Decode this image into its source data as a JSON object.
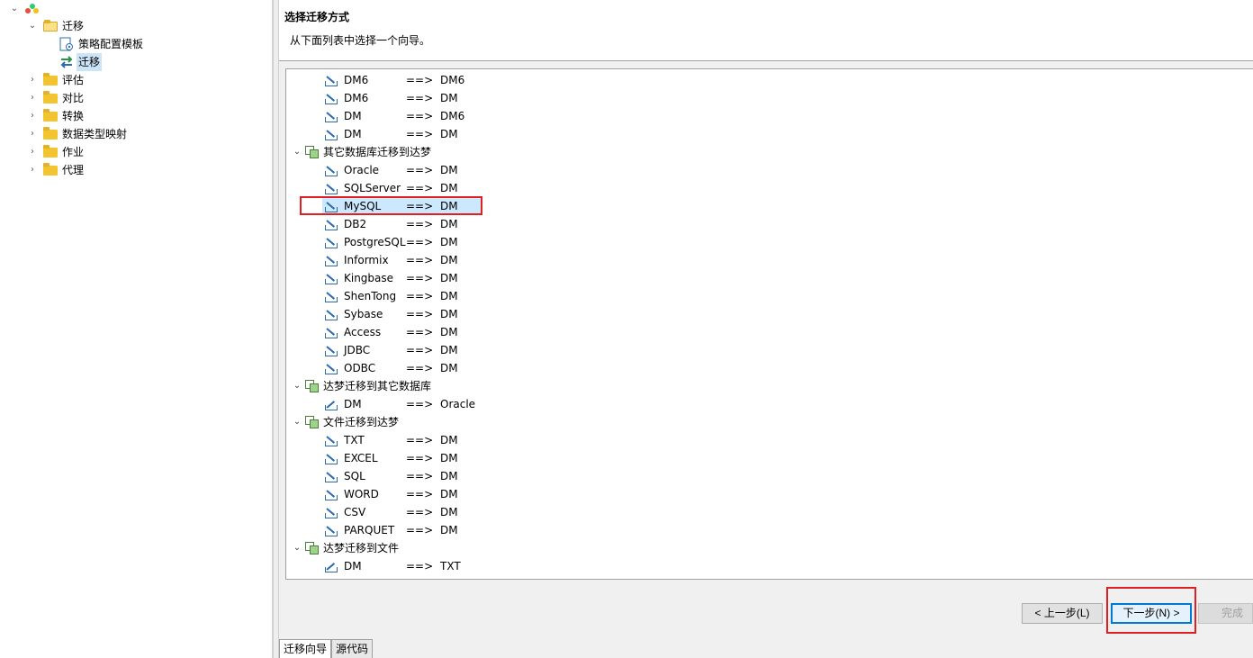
{
  "nav": {
    "root_label": "",
    "items": [
      {
        "label": "迁移",
        "expanded": true
      },
      {
        "label": "策略配置模板"
      },
      {
        "label": "迁移",
        "selected": true
      },
      {
        "label": "评估"
      },
      {
        "label": "对比"
      },
      {
        "label": "转换"
      },
      {
        "label": "数据类型映射"
      },
      {
        "label": "作业"
      },
      {
        "label": "代理"
      }
    ]
  },
  "wizard": {
    "title": "选择迁移方式",
    "subtitle": "从下面列表中选择一个向导。",
    "rows": [
      {
        "kind": "item",
        "src": "DM6",
        "arrow": "==>",
        "dst": "DM6",
        "icon": "import-icon"
      },
      {
        "kind": "item",
        "src": "DM6",
        "arrow": "==>",
        "dst": "DM",
        "icon": "import-icon"
      },
      {
        "kind": "item",
        "src": "DM",
        "arrow": "==>",
        "dst": "DM6",
        "icon": "import-icon"
      },
      {
        "kind": "item",
        "src": "DM",
        "arrow": "==>",
        "dst": "DM",
        "icon": "import-icon"
      },
      {
        "kind": "group",
        "label": "其它数据库迁移到达梦"
      },
      {
        "kind": "item",
        "src": "Oracle",
        "arrow": "==>",
        "dst": "DM",
        "icon": "import-icon"
      },
      {
        "kind": "item",
        "src": "SQLServer",
        "arrow": "==>",
        "dst": "DM",
        "icon": "import-icon"
      },
      {
        "kind": "item",
        "src": "MySQL",
        "arrow": "==>",
        "dst": "DM",
        "icon": "import-icon",
        "selected": true
      },
      {
        "kind": "item",
        "src": "DB2",
        "arrow": "==>",
        "dst": "DM",
        "icon": "import-icon"
      },
      {
        "kind": "item",
        "src": "PostgreSQL",
        "arrow": "==>",
        "dst": "DM",
        "icon": "import-icon"
      },
      {
        "kind": "item",
        "src": "Informix",
        "arrow": "==>",
        "dst": "DM",
        "icon": "import-icon"
      },
      {
        "kind": "item",
        "src": "Kingbase",
        "arrow": "==>",
        "dst": "DM",
        "icon": "import-icon"
      },
      {
        "kind": "item",
        "src": "ShenTong",
        "arrow": "==>",
        "dst": "DM",
        "icon": "import-icon"
      },
      {
        "kind": "item",
        "src": "Sybase",
        "arrow": "==>",
        "dst": "DM",
        "icon": "import-icon"
      },
      {
        "kind": "item",
        "src": "Access",
        "arrow": "==>",
        "dst": "DM",
        "icon": "import-icon"
      },
      {
        "kind": "item",
        "src": "JDBC",
        "arrow": "==>",
        "dst": "DM",
        "icon": "import-icon"
      },
      {
        "kind": "item",
        "src": "ODBC",
        "arrow": "==>",
        "dst": "DM",
        "icon": "import-icon"
      },
      {
        "kind": "group",
        "label": "达梦迁移到其它数据库"
      },
      {
        "kind": "item",
        "src": "DM",
        "arrow": "==>",
        "dst": "Oracle",
        "icon": "export-icon"
      },
      {
        "kind": "group",
        "label": "文件迁移到达梦"
      },
      {
        "kind": "item",
        "src": "TXT",
        "arrow": "==>",
        "dst": "DM",
        "icon": "import-icon"
      },
      {
        "kind": "item",
        "src": "EXCEL",
        "arrow": "==>",
        "dst": "DM",
        "icon": "import-icon"
      },
      {
        "kind": "item",
        "src": "SQL",
        "arrow": "==>",
        "dst": "DM",
        "icon": "import-icon"
      },
      {
        "kind": "item",
        "src": "WORD",
        "arrow": "==>",
        "dst": "DM",
        "icon": "import-icon"
      },
      {
        "kind": "item",
        "src": "CSV",
        "arrow": "==>",
        "dst": "DM",
        "icon": "import-icon"
      },
      {
        "kind": "item",
        "src": "PARQUET",
        "arrow": "==>",
        "dst": "DM",
        "icon": "import-icon"
      },
      {
        "kind": "group",
        "label": "达梦迁移到文件"
      },
      {
        "kind": "item",
        "src": "DM",
        "arrow": "==>",
        "dst": "TXT",
        "icon": "export-icon"
      }
    ],
    "buttons": {
      "back": "< 上一步(L)",
      "next": "下一步(N) >",
      "finish": "完成(F)"
    },
    "tabs": [
      "迁移向导",
      "源代码"
    ]
  },
  "colors": {
    "highlight_box": "#e02020",
    "selection": "#cce8ff",
    "default_button_border": "#0078d7"
  }
}
